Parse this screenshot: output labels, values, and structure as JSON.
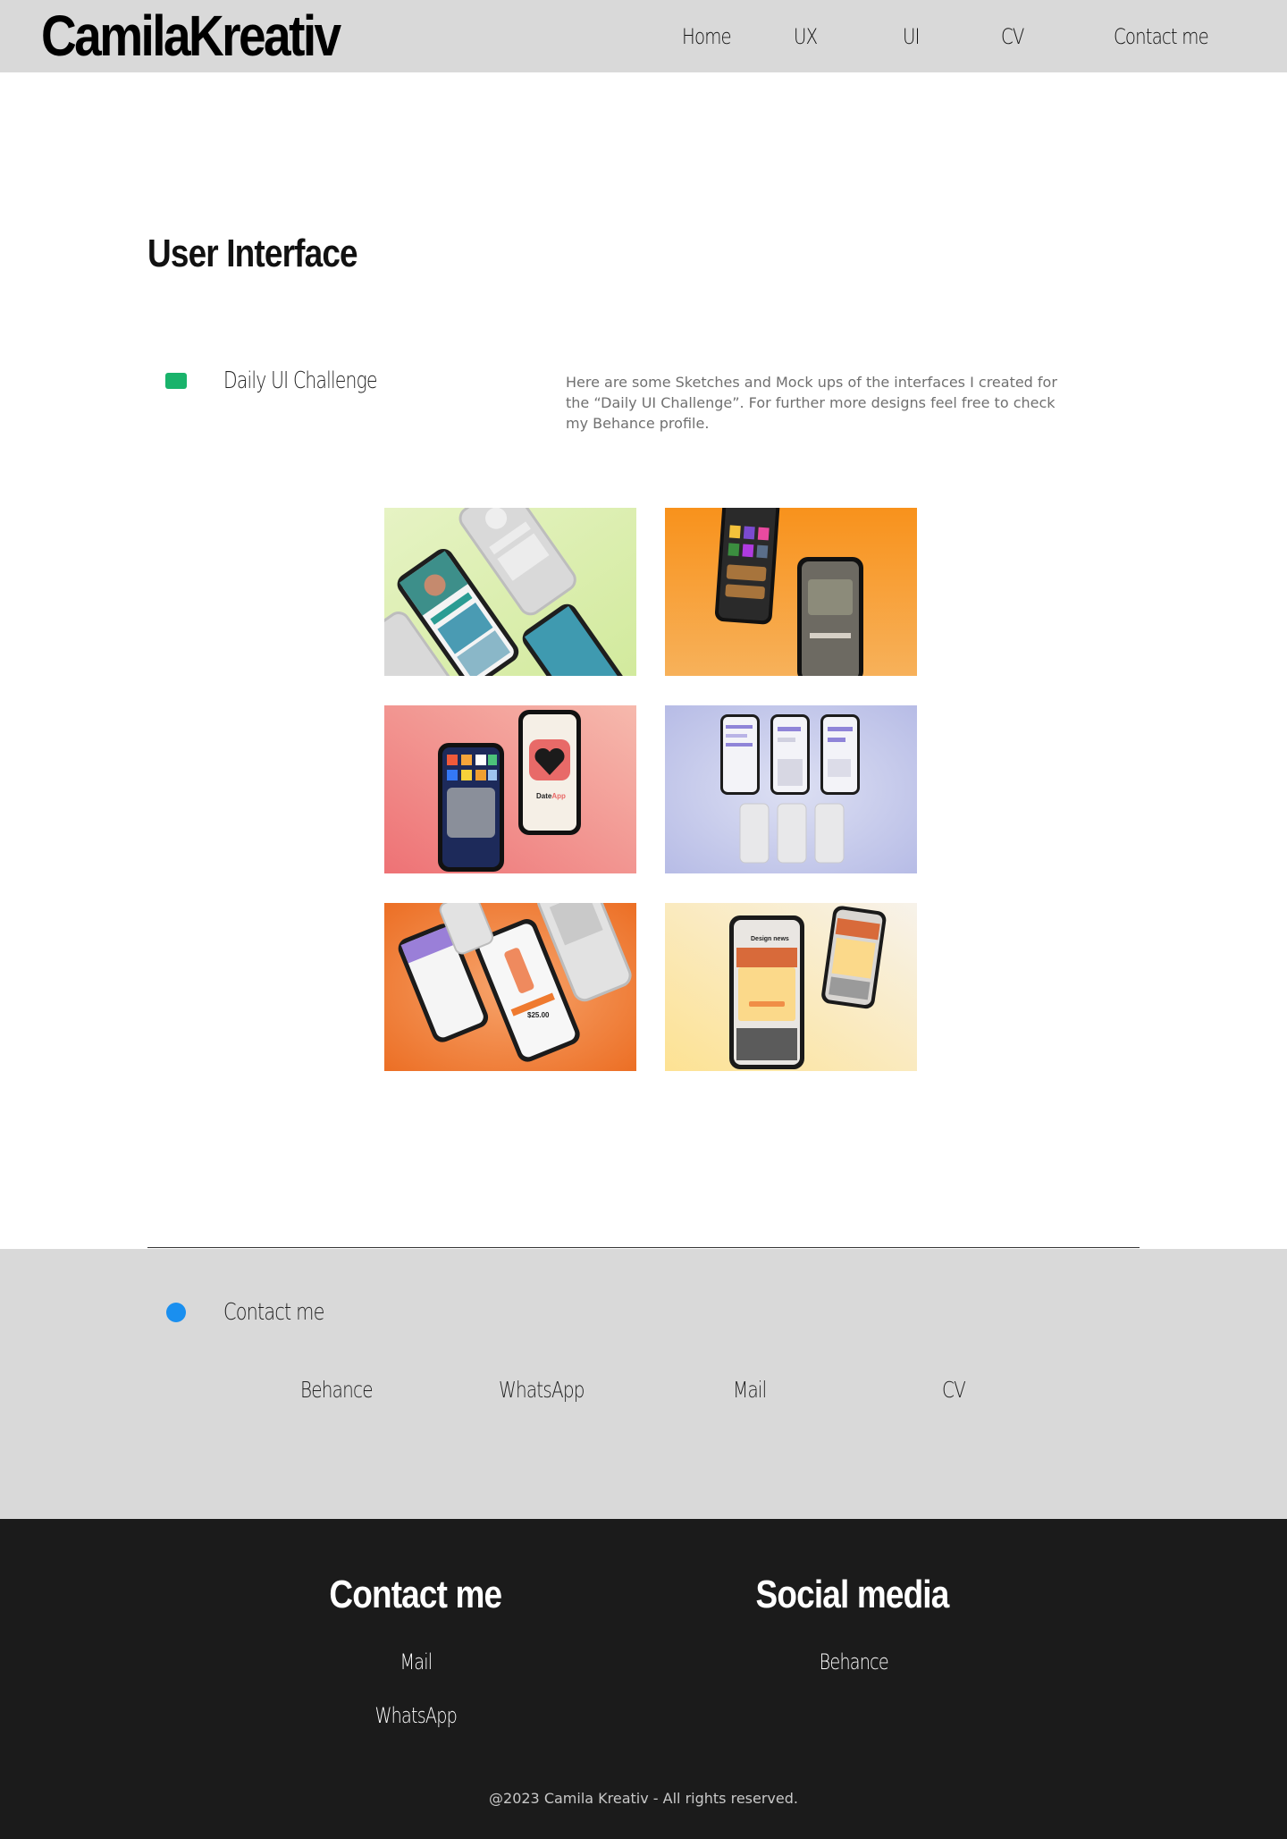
{
  "header": {
    "logo": "CamilaKreativ",
    "nav": [
      {
        "label": "Home"
      },
      {
        "label": "UX"
      },
      {
        "label": "UI"
      },
      {
        "label": "CV"
      },
      {
        "label": "Contact me"
      }
    ]
  },
  "main": {
    "title": "User Interface",
    "project": {
      "label": "Daily UI Challenge",
      "description": "Here are some Sketches and Mock ups of the interfaces I created for the “Daily UI Challenge”. For further more designs feel free to check my Behance profile.",
      "marker_color": "#19b36b"
    },
    "gallery": [
      {
        "name": "profile-app-mockup",
        "bg": "#dcefb4"
      },
      {
        "name": "music-app-mockup",
        "bg": "#f7941d"
      },
      {
        "name": "dating-app-mockup",
        "bg": "#f08a88",
        "app_name_a": "Date",
        "app_name_b": "App"
      },
      {
        "name": "chat-app-mockup",
        "bg": "#c7cbeb"
      },
      {
        "name": "shop-app-mockup",
        "bg": "#ef7d33",
        "price": "$25.00"
      },
      {
        "name": "newsletter-app-mockup",
        "bg": "#fbe7a6",
        "heading": "Design news"
      }
    ]
  },
  "contact_strip": {
    "label": "Contact me",
    "dot_color": "#1a8fef",
    "links": [
      {
        "label": "Behance"
      },
      {
        "label": "WhatsApp"
      },
      {
        "label": "Mail"
      },
      {
        "label": "CV"
      }
    ]
  },
  "footer": {
    "contact_heading": "Contact me",
    "contact_links": [
      {
        "label": "Mail"
      },
      {
        "label": "WhatsApp"
      }
    ],
    "social_heading": "Social media",
    "social_links": [
      {
        "label": "Behance"
      }
    ],
    "copyright": "@2023 Camila Kreativ - All rights reserved."
  }
}
